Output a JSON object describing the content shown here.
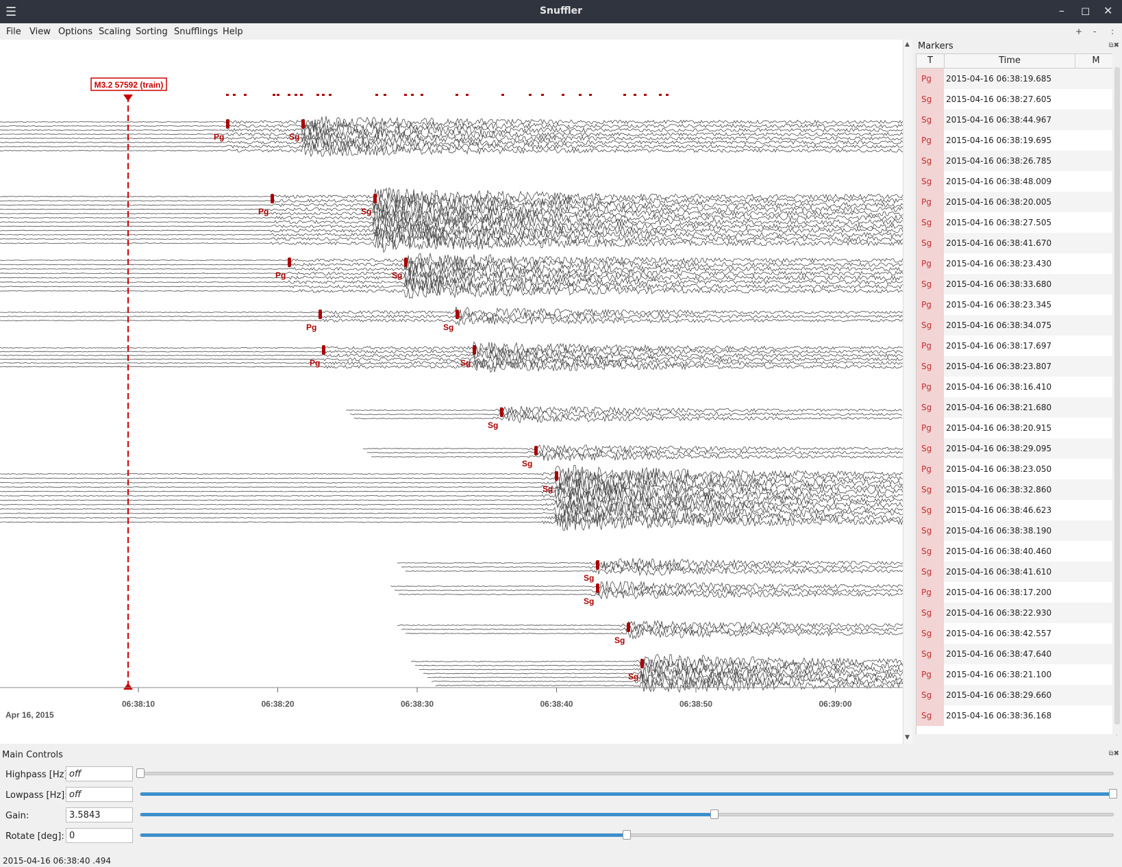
{
  "window": {
    "title": "Snuffler"
  },
  "menu": [
    "File",
    "View",
    "Options",
    "Scaling",
    "Sorting",
    "Snufflings",
    "Help"
  ],
  "toolbar": {
    "zoom_in": "+",
    "zoom_out": "-",
    "more": ":"
  },
  "trace_view": {
    "event_label": "M3.2 57592 (train)",
    "date_label": "Apr 16, 2015",
    "time_ticks": [
      "06:38:10",
      "06:38:20",
      "06:38:30",
      "06:38:40",
      "06:38:50",
      "06:39:00"
    ],
    "colors": {
      "marker": "#aa0000",
      "trace": "#4a4a4a"
    }
  },
  "markers_panel": {
    "title": "Markers",
    "columns": [
      "T",
      "Time",
      "M"
    ],
    "rows": [
      {
        "t": "Pg",
        "time": "2015-04-16 06:38:19.685"
      },
      {
        "t": "Sg",
        "time": "2015-04-16 06:38:27.605"
      },
      {
        "t": "Sg",
        "time": "2015-04-16 06:38:44.967"
      },
      {
        "t": "Pg",
        "time": "2015-04-16 06:38:19.695"
      },
      {
        "t": "Sg",
        "time": "2015-04-16 06:38:26.785"
      },
      {
        "t": "Sg",
        "time": "2015-04-16 06:38:48.009"
      },
      {
        "t": "Pg",
        "time": "2015-04-16 06:38:20.005"
      },
      {
        "t": "Sg",
        "time": "2015-04-16 06:38:27.505"
      },
      {
        "t": "Sg",
        "time": "2015-04-16 06:38:41.670"
      },
      {
        "t": "Pg",
        "time": "2015-04-16 06:38:23.430"
      },
      {
        "t": "Sg",
        "time": "2015-04-16 06:38:33.680"
      },
      {
        "t": "Pg",
        "time": "2015-04-16 06:38:23.345"
      },
      {
        "t": "Sg",
        "time": "2015-04-16 06:38:34.075"
      },
      {
        "t": "Pg",
        "time": "2015-04-16 06:38:17.697"
      },
      {
        "t": "Sg",
        "time": "2015-04-16 06:38:23.807"
      },
      {
        "t": "Pg",
        "time": "2015-04-16 06:38:16.410"
      },
      {
        "t": "Sg",
        "time": "2015-04-16 06:38:21.680"
      },
      {
        "t": "Pg",
        "time": "2015-04-16 06:38:20.915"
      },
      {
        "t": "Sg",
        "time": "2015-04-16 06:38:29.095"
      },
      {
        "t": "Pg",
        "time": "2015-04-16 06:38:23.050"
      },
      {
        "t": "Sg",
        "time": "2015-04-16 06:38:32.860"
      },
      {
        "t": "Sg",
        "time": "2015-04-16 06:38:46.623"
      },
      {
        "t": "Sg",
        "time": "2015-04-16 06:38:38.190"
      },
      {
        "t": "Sg",
        "time": "2015-04-16 06:38:40.460"
      },
      {
        "t": "Sg",
        "time": "2015-04-16 06:38:41.610"
      },
      {
        "t": "Pg",
        "time": "2015-04-16 06:38:17.200"
      },
      {
        "t": "Sg",
        "time": "2015-04-16 06:38:22.930"
      },
      {
        "t": "Sg",
        "time": "2015-04-16 06:38:42.557"
      },
      {
        "t": "Sg",
        "time": "2015-04-16 06:38:47.640"
      },
      {
        "t": "Pg",
        "time": "2015-04-16 06:38:21.100"
      },
      {
        "t": "Sg",
        "time": "2015-04-16 06:38:29.660"
      },
      {
        "t": "Sg",
        "time": "2015-04-16 06:38:36.168"
      }
    ]
  },
  "main_controls": {
    "title": "Main Controls",
    "highpass": {
      "label": "Highpass [Hz]:",
      "value": "off",
      "fraction": 0.0
    },
    "lowpass": {
      "label": "Lowpass [Hz]:",
      "value": "off",
      "fraction": 1.0
    },
    "gain": {
      "label": "Gain:",
      "value": "3.5843",
      "fraction": 0.59
    },
    "rotate": {
      "label": "Rotate [deg]:",
      "value": "0",
      "fraction": 0.5
    }
  },
  "status": {
    "text": "2015-04-16 06:38:40 .494"
  }
}
